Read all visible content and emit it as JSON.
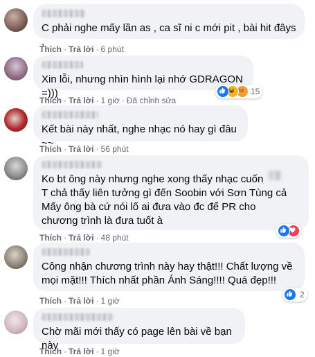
{
  "like_label": "Thích",
  "reply_label": "Trả lời",
  "separator": "·",
  "colors": {
    "like": "#1877f2",
    "haha": "#f7b125",
    "love": "#f33e58",
    "bubble": "#f0f2f5",
    "meta": "#65676b"
  },
  "comments": [
    {
      "text": "C phải nghe mấy lần as , ca sĩ ni c mới pit , bài hit đâys ,",
      "time": "6 phút",
      "edited": "",
      "reactions": ""
    },
    {
      "text": "Xin lỗi, nhưng nhìn hình lại nhớ GDRAGON =)))",
      "time": "1 giờ",
      "edited": "Đã chỉnh sửa",
      "reactions": "15"
    },
    {
      "text": "Kết bài này nhất, nghe nhạc nó hay gì đâu ~~",
      "time": "56 phút",
      "edited": "",
      "reactions": ""
    },
    {
      "text": "Ko bt ông này nhưng nghe xong thấy nhạc cuốn\nT chả thấy liên tưởng gì đến Soobin với Sơn Tùng cả\nMấy ông bà cứ nói lố ai đưa vào đc để PR cho chương trình là đưa tuốt à",
      "time": "48 phút",
      "edited": "",
      "reactions": ""
    },
    {
      "text": "Công nhận chương trình này hay thật!!! Chất lượng về mọi mặt!!! Thích nhất phần Ánh Sáng!!!! Quá đẹp!!!",
      "time": "1 giờ",
      "edited": "",
      "reactions": "2"
    },
    {
      "text": "Chờ mãi mới thấy có page lên bài về bạn này",
      "time": "1 giờ",
      "edited": "",
      "reactions": ""
    }
  ]
}
